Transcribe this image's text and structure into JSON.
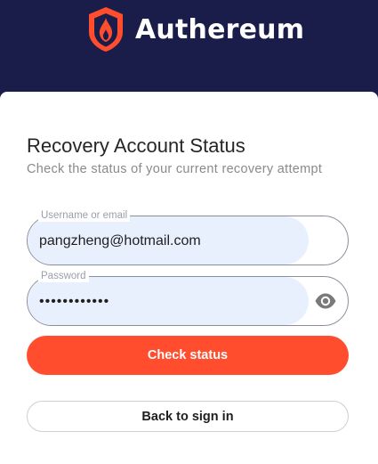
{
  "brand": {
    "name": "Authereum",
    "logo_icon": "authereum-logo-icon",
    "accent_color": "#ff4d2e",
    "header_color": "#1a1d4a"
  },
  "form": {
    "title": "Recovery Account Status",
    "subtitle": "Check the status of your current recovery attempt",
    "username": {
      "label": "Username or email",
      "value": "pangzheng@hotmail.com"
    },
    "password": {
      "label": "Password",
      "value": "••••••••••••",
      "toggle_icon": "eye-icon"
    },
    "submit_label": "Check status",
    "back_label": "Back to sign in"
  }
}
